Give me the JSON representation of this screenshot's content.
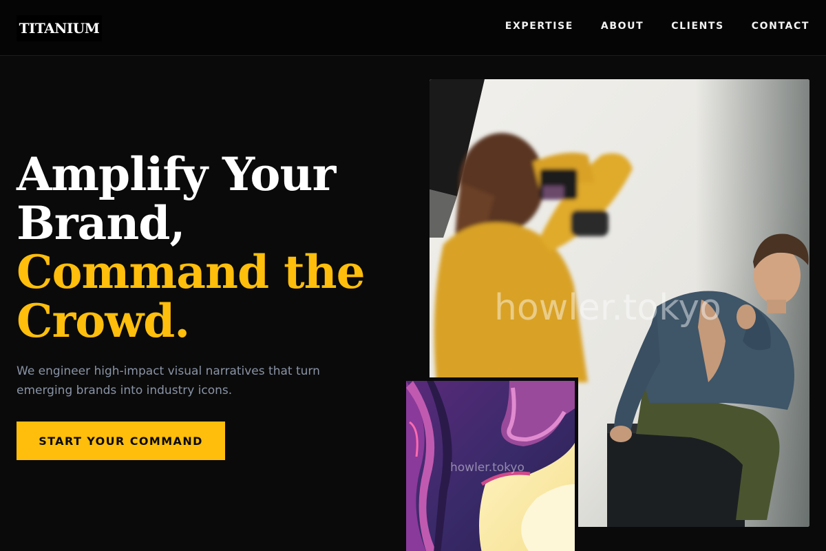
{
  "brand": {
    "logo": "TITANIUM"
  },
  "nav": {
    "items": [
      "EXPERTISE",
      "ABOUT",
      "CLIENTS",
      "CONTACT"
    ]
  },
  "hero": {
    "title_lines": [
      "Amplify Your",
      "Brand,"
    ],
    "accent_lines": [
      "Command the",
      "Crowd."
    ],
    "subtitle": "We engineer high-impact visual narratives that turn emerging brands into industry icons.",
    "cta_label": "START YOUR COMMAND"
  },
  "images": {
    "main_watermark": "howler.tokyo",
    "art_watermark": "howler.tokyo"
  },
  "colors": {
    "accent": "#ffbe0b",
    "background": "#0a0a0a",
    "subtitle": "#8a94a6"
  }
}
